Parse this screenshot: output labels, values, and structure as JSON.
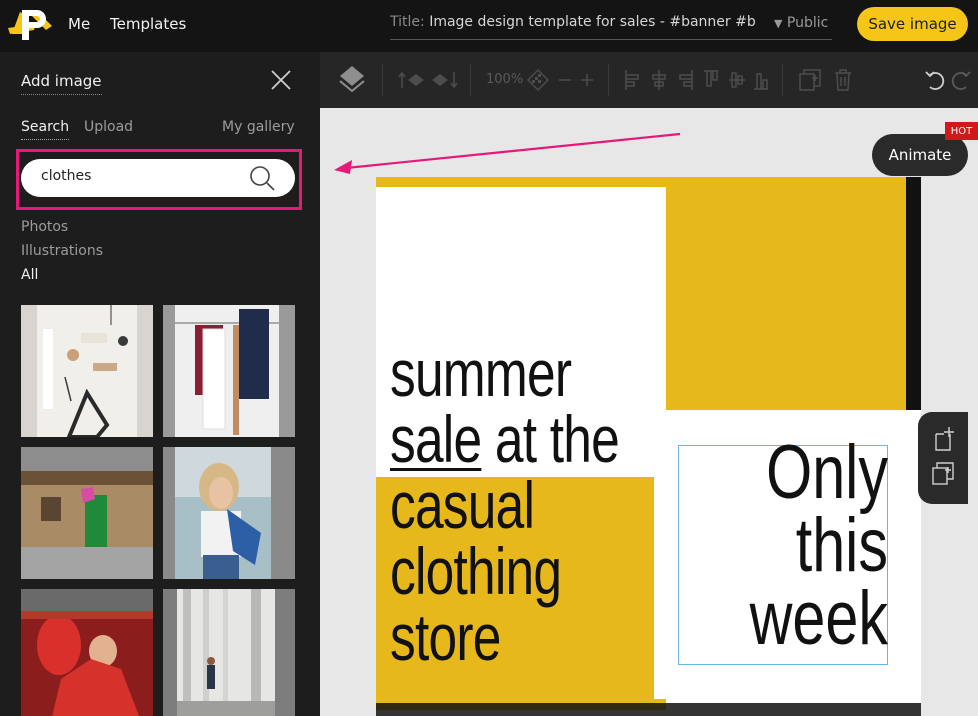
{
  "header": {
    "nav_me": "Me",
    "nav_templates": "Templates",
    "title_label": "Title:",
    "title_value": "Image design template for sales - #banner #b",
    "visibility": "Public",
    "save_label": "Save image"
  },
  "sidebar": {
    "title": "Add image",
    "tabs": [
      "Search",
      "Upload",
      "My gallery"
    ],
    "search_value": "clothes",
    "filters": [
      "Photos",
      "Illustrations",
      "All"
    ],
    "active_filter": "All"
  },
  "toolbar": {
    "zoom": "100%"
  },
  "canvas": {
    "animate_label": "Animate",
    "hot_badge": "HOT",
    "headline_lines": [
      "summer",
      "sale",
      "at the",
      "casual",
      "clothing",
      "store"
    ],
    "subline_lines": [
      "Only",
      "this",
      "week"
    ]
  },
  "colors": {
    "accent_yellow": "#f5c518",
    "highlight_pink": "#e6197b",
    "banner_yellow": "#e7b81c"
  }
}
